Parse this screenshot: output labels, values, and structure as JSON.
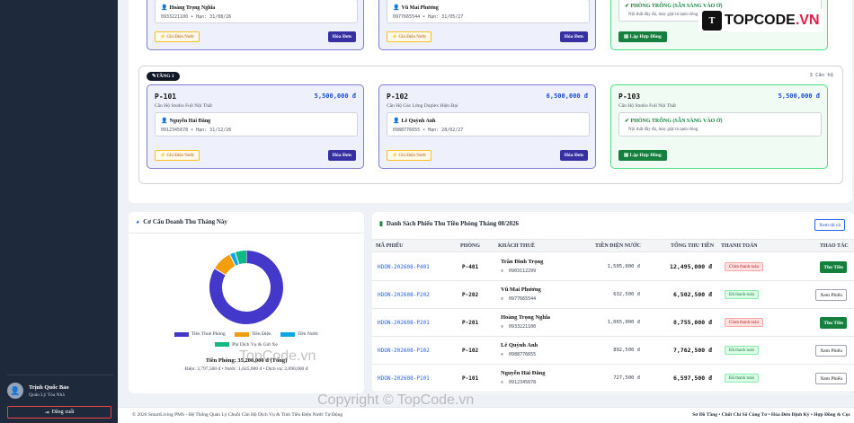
{
  "logo": {
    "mark": "T",
    "text_main": "TOPCODE",
    "text_tld": ".VN"
  },
  "sidebar": {
    "user_name": "Trịnh Quốc Bảo",
    "user_role": "Quản Lý Tòa Nhà",
    "logout_label": "Đăng xuất"
  },
  "floor2_partial": {
    "rooms": [
      {
        "tenant": "Hoàng Trọng Nghĩa",
        "meta": "0933221100 • Hạn: 31/08/26",
        "meter_label": "Ghi Điện Nước",
        "invoice_label": "Hóa Đơn"
      },
      {
        "tenant": "Vũ Mai Phương",
        "meta": "0977665544 • Hạn: 31/05/27",
        "meter_label": "Ghi Điện Nước",
        "invoice_label": "Hóa Đơn"
      }
    ],
    "empty": {
      "title": "PHÒNG TRỐNG (SẴN SÀNG VÀO Ở)",
      "desc": "Nội thất đầy đủ, máy giặt tủ lạnh riêng",
      "button": "Lập Hợp Đồng"
    }
  },
  "floor1": {
    "tag": "TẦNG 1",
    "count": "3 Căn hộ",
    "rooms": [
      {
        "code": "P-101",
        "price": "5,500,000 đ",
        "type": "Căn Hộ Studio Full Nội Thất",
        "tenant": "Nguyễn Hải Đăng",
        "meta": "0912345678 • Hạn: 31/12/26",
        "meter_label": "Ghi Điện Nước",
        "invoice_label": "Hóa Đơn"
      },
      {
        "code": "P-102",
        "price": "6,500,000 đ",
        "type": "Căn Hộ Gác Lửng Duplex Hiện Đại",
        "tenant": "Lê Quỳnh Anh",
        "meta": "0988776655 • Hạn: 28/02/27",
        "meter_label": "Ghi Điện Nước",
        "invoice_label": "Hóa Đơn"
      },
      {
        "code": "P-103",
        "price": "5,500,000 đ",
        "type": "Căn Hộ Studio Full Nội Thất",
        "empty_title": "PHÒNG TRỐNG (SẴN SÀNG VÀO Ở)",
        "empty_desc": "Nội thất đầy đủ, máy giặt tủ lạnh riêng",
        "button": "Lập Hợp Đồng"
      }
    ]
  },
  "revenue": {
    "title": "Cơ Cấu Doanh Thu Tháng Này",
    "total": "Tiền Phòng: 35,200,000 đ (Tổng)",
    "detail": "Điện: 3,797,500 đ • Nước: 1,025,000 đ • Dịch vụ: 2,090,000 đ"
  },
  "chart_data": {
    "type": "pie",
    "categories": [
      "Tiền Thuê Phòng",
      "Tiền Điện",
      "Tiền Nước",
      "Phí Dịch Vụ & Gửi Xe"
    ],
    "values": [
      35200000,
      3797500,
      1025000,
      2090000
    ],
    "colors": [
      "#4338ca",
      "#f59e0b",
      "#0ea5e9",
      "#10b981"
    ],
    "legend_position": "bottom"
  },
  "invoices": {
    "title": "Danh Sách Phiếu Thu Tiền Phòng Tháng 08/2026",
    "view_all": "Xem tất cả",
    "headers": [
      "MÃ PHIẾU",
      "PHÒNG",
      "KHÁCH THUÊ",
      "TIỀN ĐIỆN NƯỚC",
      "TỔNG THU TIỀN",
      "THANH TOÁN",
      "THAO TÁC"
    ],
    "rows": [
      {
        "code": "HDON-202608-P401",
        "room": "P-401",
        "name": "Trần Đình Trọng",
        "phone": "0903112299",
        "utility": "1,505,000 đ",
        "total": "12,495,000 đ",
        "status": "Chưa thanh toán",
        "paid": false,
        "action": "Thu Tiền"
      },
      {
        "code": "HDON-202608-P202",
        "room": "P-202",
        "name": "Vũ Mai Phương",
        "phone": "0977665544",
        "utility": "632,500 đ",
        "total": "6,502,500 đ",
        "status": "Đã thanh toán",
        "paid": true,
        "action": "Xem Phiếu"
      },
      {
        "code": "HDON-202608-P201",
        "room": "P-201",
        "name": "Hoàng Trọng Nghĩa",
        "phone": "0933221100",
        "utility": "1,065,000 đ",
        "total": "8,755,000 đ",
        "status": "Chưa thanh toán",
        "paid": false,
        "action": "Thu Tiền"
      },
      {
        "code": "HDON-202608-P102",
        "room": "P-102",
        "name": "Lê Quỳnh Anh",
        "phone": "0988776655",
        "utility": "892,500 đ",
        "total": "7,762,500 đ",
        "status": "Đã thanh toán",
        "paid": true,
        "action": "Xem Phiếu"
      },
      {
        "code": "HDON-202608-P101",
        "room": "P-101",
        "name": "Nguyễn Hải Đăng",
        "phone": "0912345678",
        "utility": "727,500 đ",
        "total": "6,597,500 đ",
        "status": "Đã thanh toán",
        "paid": true,
        "action": "Xem Phiếu"
      }
    ]
  },
  "footer": {
    "left": "© 2026 SmartLiving PMS - Hệ Thống Quản Lý Chuỗi Căn Hộ Dịch Vụ & Tính Tiền Điện Nước Tự Động",
    "right": "Sơ Đồ Tầng • Chốt Chỉ Số Công Tơ • Hóa Đơn Định Kỳ • Hợp Đồng & Cọc"
  },
  "watermarks": {
    "center": "TopCode.vn",
    "bottom": "Copyright © TopCode.vn"
  }
}
